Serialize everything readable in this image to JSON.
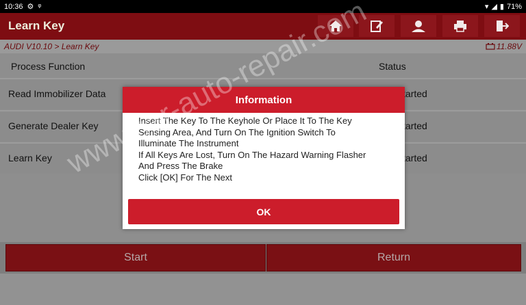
{
  "status_bar": {
    "time": "10:36",
    "battery": "71%"
  },
  "app": {
    "title": "Learn Key"
  },
  "toolbar": {
    "home_icon": "home-icon",
    "edit_icon": "edit-icon",
    "support_icon": "support-icon",
    "print_icon": "print-icon",
    "exit_icon": "exit-icon"
  },
  "breadcrumb": {
    "path": "AUDI V10.10 > Learn Key",
    "voltage": "11.88V"
  },
  "table": {
    "headers": {
      "function": "Process Function",
      "status": "Status"
    },
    "rows": [
      {
        "function": "Read Immobilizer Data",
        "status": "Not Started"
      },
      {
        "function": "Generate Dealer Key",
        "status": "Not Started"
      },
      {
        "function": "Learn Key",
        "status": "Not Started"
      }
    ]
  },
  "buttons": {
    "start": "Start",
    "return": "Return"
  },
  "dialog": {
    "title": "Information",
    "lines": [
      "Insert The Key To The Keyhole Or Place It To The Key",
      "Sensing Area, And Turn On The Ignition Switch To",
      "Illuminate The Instrument",
      "If All Keys Are Lost, Turn On The Hazard Warning Flasher",
      "And Press The Brake",
      "Click [OK] For The Next"
    ],
    "ok_label": "OK"
  },
  "watermark": {
    "text": "www.car-auto-repair.com"
  },
  "colors": {
    "brand_red": "#cc1d2b",
    "appbar": "#7e0d12"
  }
}
